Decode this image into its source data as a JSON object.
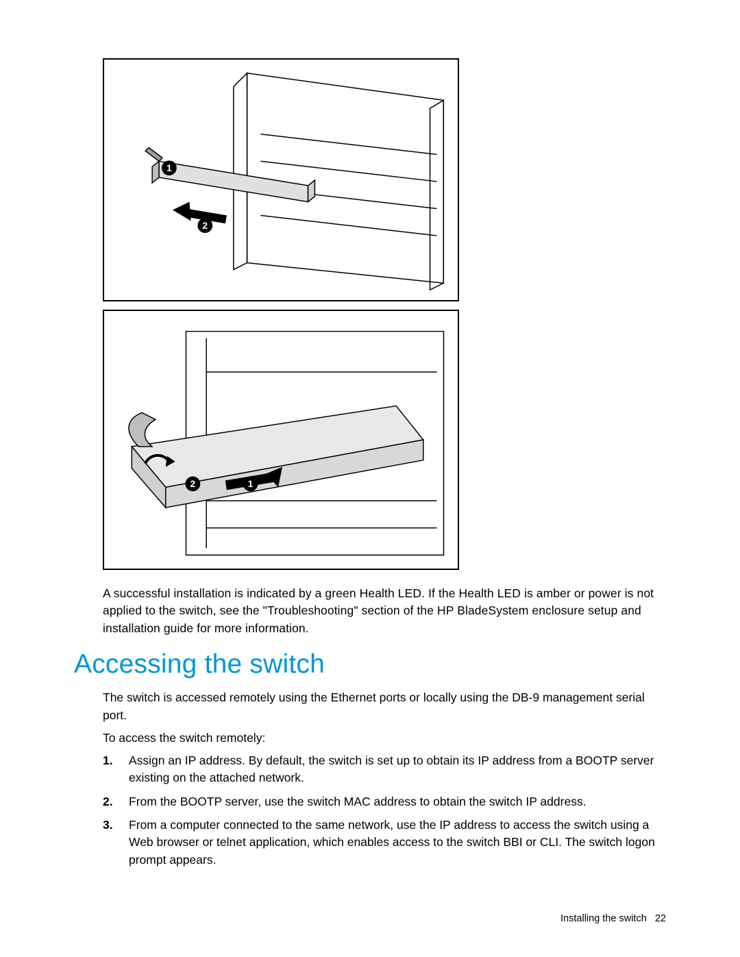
{
  "figures": {
    "top_alt": "Switch module being removed from upper bay of enclosure, callouts 1 and 2 with arrow indicating direction",
    "bottom_alt": "Switch module being inserted into lower front bay of enclosure, callouts 1 and 2 with arrow indicating direction"
  },
  "paragraph_after_figures": "A successful installation is indicated by a green Health LED. If the Health LED is amber or power is not applied to the switch, see the \"Troubleshooting\" section of the HP BladeSystem enclosure setup and installation guide for more information.",
  "section_heading": "Accessing the switch",
  "intro": "The switch is accessed remotely using the Ethernet ports or locally using the DB-9 management serial port.",
  "lead_in": "To access the switch remotely:",
  "steps": [
    {
      "num": "1.",
      "text": "Assign an IP address. By default, the switch is set up to obtain its IP address from a BOOTP server existing on the attached network."
    },
    {
      "num": "2.",
      "text": "From the BOOTP server, use the switch MAC address to obtain the switch IP address."
    },
    {
      "num": "3.",
      "text": "From a computer connected to the same network, use the IP address to access the switch using a Web browser or telnet application, which enables access to the switch BBI or CLI. The switch logon prompt appears."
    }
  ],
  "footer": {
    "section": "Installing the switch",
    "page": "22"
  }
}
